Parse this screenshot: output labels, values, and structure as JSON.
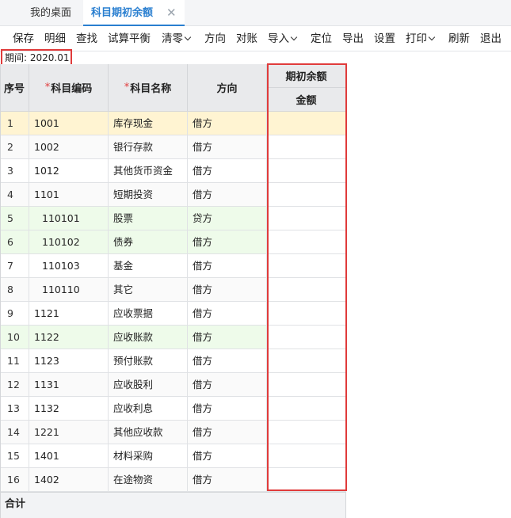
{
  "tabs": [
    {
      "label": "我的桌面"
    },
    {
      "label": "科目期初余额",
      "close": "✕"
    }
  ],
  "toolbar": {
    "save": "保存",
    "detail": "明细",
    "find": "查找",
    "trial_balance": "试算平衡",
    "clear": "清零",
    "direction": "方向",
    "reconcile": "对账",
    "import": "导入",
    "locate": "定位",
    "export": "导出",
    "settings": "设置",
    "print": "打印",
    "refresh": "刷新",
    "exit": "退出"
  },
  "period": "期间: 2020.01",
  "table": {
    "headers": {
      "seq": "序号",
      "code": "科目编码",
      "name": "科目名称",
      "direction": "方向",
      "opening_balance": "期初余额",
      "amount": "金额"
    },
    "rows": [
      {
        "seq": "1",
        "code": "1001",
        "name": "库存现金",
        "direction": "借方",
        "amount": ""
      },
      {
        "seq": "2",
        "code": "1002",
        "name": "银行存款",
        "direction": "借方",
        "amount": ""
      },
      {
        "seq": "3",
        "code": "1012",
        "name": "其他货币资金",
        "direction": "借方",
        "amount": ""
      },
      {
        "seq": "4",
        "code": "1101",
        "name": "短期投资",
        "direction": "借方",
        "amount": ""
      },
      {
        "seq": "5",
        "code": "110101",
        "name": "股票",
        "direction": "贷方",
        "amount": ""
      },
      {
        "seq": "6",
        "code": "110102",
        "name": "债券",
        "direction": "借方",
        "amount": ""
      },
      {
        "seq": "7",
        "code": "110103",
        "name": "基金",
        "direction": "借方",
        "amount": ""
      },
      {
        "seq": "8",
        "code": "110110",
        "name": "其它",
        "direction": "借方",
        "amount": ""
      },
      {
        "seq": "9",
        "code": "1121",
        "name": "应收票据",
        "direction": "借方",
        "amount": ""
      },
      {
        "seq": "10",
        "code": "1122",
        "name": "应收账款",
        "direction": "借方",
        "amount": ""
      },
      {
        "seq": "11",
        "code": "1123",
        "name": "预付账款",
        "direction": "借方",
        "amount": ""
      },
      {
        "seq": "12",
        "code": "1131",
        "name": "应收股利",
        "direction": "借方",
        "amount": ""
      },
      {
        "seq": "13",
        "code": "1132",
        "name": "应收利息",
        "direction": "借方",
        "amount": ""
      },
      {
        "seq": "14",
        "code": "1221",
        "name": "其他应收款",
        "direction": "借方",
        "amount": ""
      },
      {
        "seq": "15",
        "code": "1401",
        "name": "材料采购",
        "direction": "借方",
        "amount": ""
      },
      {
        "seq": "16",
        "code": "1402",
        "name": "在途物资",
        "direction": "借方",
        "amount": ""
      }
    ],
    "total_label": "合计"
  },
  "colors": {
    "accent": "#2a7fd0",
    "highlight_red": "#e03b3b",
    "selected_row": "#fff4d2",
    "child_row": "#eefbea"
  }
}
